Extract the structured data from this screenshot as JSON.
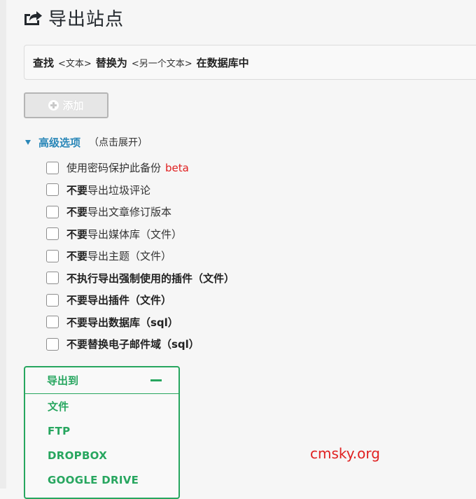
{
  "header": {
    "title": "导出站点",
    "icon": "export-share-icon"
  },
  "search_replace": {
    "find": "查找",
    "text_tag": "<文本>",
    "replace_with": "替换为",
    "other_tag": "<另一个文本>",
    "in_db": "在数据库中"
  },
  "add_button": {
    "label": "添加",
    "icon": "plus-circle-icon"
  },
  "advanced": {
    "label": "高级选项",
    "hint": "（点击展开）"
  },
  "options": [
    {
      "prefix": "",
      "text": "使用密码保护此备份",
      "badge": "beta"
    },
    {
      "prefix": "不要",
      "text": "导出垃圾评论"
    },
    {
      "prefix": "不要",
      "text": "导出文章修订版本"
    },
    {
      "prefix": "不要",
      "text": "导出媒体库（文件）"
    },
    {
      "prefix": "不要",
      "text": "导出主题（文件）"
    },
    {
      "text": "不执行导出强制使用的插件（文件）"
    },
    {
      "text": "不要导出插件（文件）"
    },
    {
      "text": "不要导出数据库（sql）"
    },
    {
      "text": "不要替换电子邮件域（sql）"
    }
  ],
  "export_to": {
    "label": "导出到",
    "items": [
      "文件",
      "FTP",
      "DROPBOX",
      "GOOGLE DRIVE"
    ]
  },
  "watermark": "cmsky.org",
  "colors": {
    "accent_green": "#27a65f",
    "link_blue": "#2a87b8",
    "beta_red": "#e02020"
  }
}
